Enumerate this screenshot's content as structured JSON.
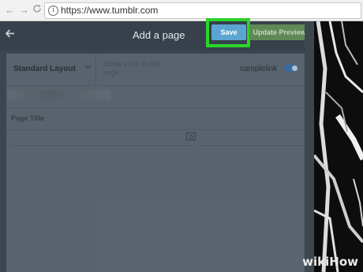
{
  "browser": {
    "url": "https://www.tumblr.com",
    "back_glyph": "←",
    "forward_glyph": "→"
  },
  "header": {
    "title": "Add a page",
    "save_label": "Save",
    "update_preview_label": "Update Preview"
  },
  "form": {
    "layout_select": "Standard Layout",
    "link_hint": "Show a link to this page",
    "toggle_label": "samplelink",
    "toggle_on": true,
    "page_title_placeholder": "Page Title"
  },
  "watermark": {
    "part1": "wiki",
    "part2": "How"
  },
  "colors": {
    "highlight": "#2bd52b",
    "save_button": "#5ba5d2",
    "preview_button": "#5f8a55"
  }
}
